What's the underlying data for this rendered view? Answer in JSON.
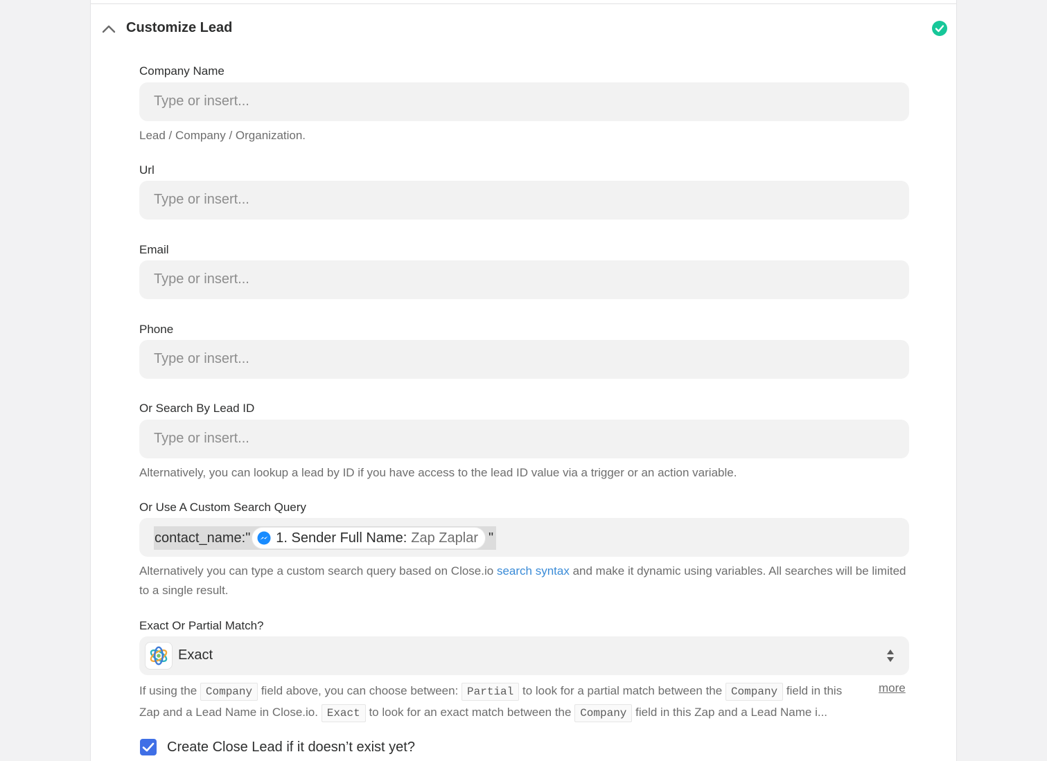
{
  "section": {
    "title": "Customize Lead",
    "status_color": "#17c799",
    "collapse_icon": "chevron-up-icon",
    "status_icon": "check-circle-icon"
  },
  "fields": {
    "company_name": {
      "label": "Company Name",
      "placeholder": "Type or insert...",
      "help": "Lead / Company / Organization."
    },
    "url": {
      "label": "Url",
      "placeholder": "Type or insert..."
    },
    "email": {
      "label": "Email",
      "placeholder": "Type or insert..."
    },
    "phone": {
      "label": "Phone",
      "placeholder": "Type or insert..."
    },
    "lead_id": {
      "label": "Or Search By Lead ID",
      "placeholder": "Type or insert...",
      "help": "Alternatively, you can lookup a lead by ID if you have access to the lead ID value via a trigger or an action variable."
    },
    "custom_query": {
      "label": "Or Use A Custom Search Query",
      "prefix": "contact_name:\"",
      "pill_icon": "messenger-icon",
      "pill_label": "1. Sender Full Name:",
      "pill_value": "Zap Zaplar",
      "suffix": "\"",
      "help_before": "Alternatively you can type a custom search query based on Close.io ",
      "help_link": "search syntax",
      "help_after": " and make it dynamic using variables. All searches will be limited to a single result."
    },
    "match": {
      "label": "Exact Or Partial Match?",
      "value": "Exact",
      "logo_icon": "close-io-logo-icon",
      "help": {
        "t1": "If using the ",
        "c1": "Company",
        "t2": " field above, you can choose between: ",
        "c2": "Partial",
        "t3": " to look for a partial match between the ",
        "c3": "Company",
        "t4": " field in this Zap and a Lead Name in Close.io. ",
        "c4": "Exact",
        "t5": " to look for an exact match between the ",
        "c5": "Company",
        "t6": " field in this Zap and a Lead Name i...",
        "more": "more"
      }
    },
    "create_if_missing": {
      "label": "Create Close Lead if it doesn’t exist yet?",
      "checked": true
    }
  }
}
